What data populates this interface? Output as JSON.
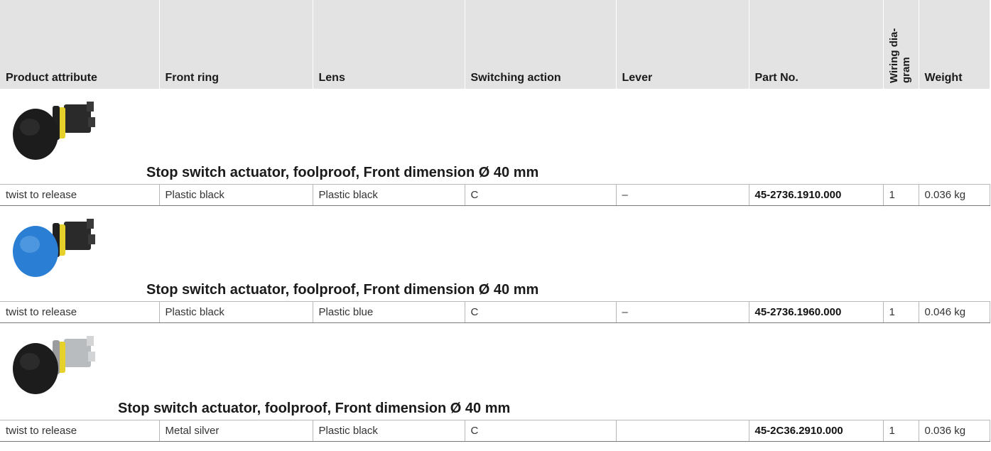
{
  "headers": {
    "product_attribute": "Product attribute",
    "front_ring": "Front ring",
    "lens": "Lens",
    "switching_action": "Switching action",
    "lever": "Lever",
    "part_no": "Part No.",
    "wiring_line1": "Wiring dia-",
    "wiring_line2": "gram",
    "weight": "Weight"
  },
  "products": [
    {
      "title": "Stop switch actuator, foolproof, Front dimension Ø 40 mm",
      "image_icon": "black-mushroom-actuator-icon",
      "mushroom_color": "#1c1c1c",
      "body_color": "#2a2a2a",
      "row": {
        "product_attribute": "twist to release",
        "front_ring": "Plastic black",
        "lens": "Plastic black",
        "switching_action": "C",
        "lever": "–",
        "part_no": "45-2736.1910.000",
        "wiring_diagram": "1",
        "weight": "0.036 kg"
      }
    },
    {
      "title": "Stop switch actuator, foolproof, Front dimension Ø 40 mm",
      "image_icon": "blue-mushroom-actuator-icon",
      "mushroom_color": "#2a7fd4",
      "body_color": "#2a2a2a",
      "row": {
        "product_attribute": "twist to release",
        "front_ring": "Plastic black",
        "lens": "Plastic blue",
        "switching_action": "C",
        "lever": "–",
        "part_no": "45-2736.1960.000",
        "wiring_diagram": "1",
        "weight": "0.046 kg"
      }
    },
    {
      "title": "Stop switch actuator, foolproof, Front dimension Ø 40 mm",
      "image_icon": "black-mushroom-metal-actuator-icon",
      "mushroom_color": "#1c1c1c",
      "body_color": "#b9bcbf",
      "row": {
        "product_attribute": "twist to release",
        "front_ring": "Metal silver",
        "lens": "Plastic black",
        "switching_action": "C",
        "lever": "",
        "part_no": "45-2C36.2910.000",
        "wiring_diagram": "1",
        "weight": "0.036 kg"
      }
    }
  ],
  "colors": {
    "header_bg": "#e3e3e3",
    "yellow_ring": "#e6d12a"
  }
}
